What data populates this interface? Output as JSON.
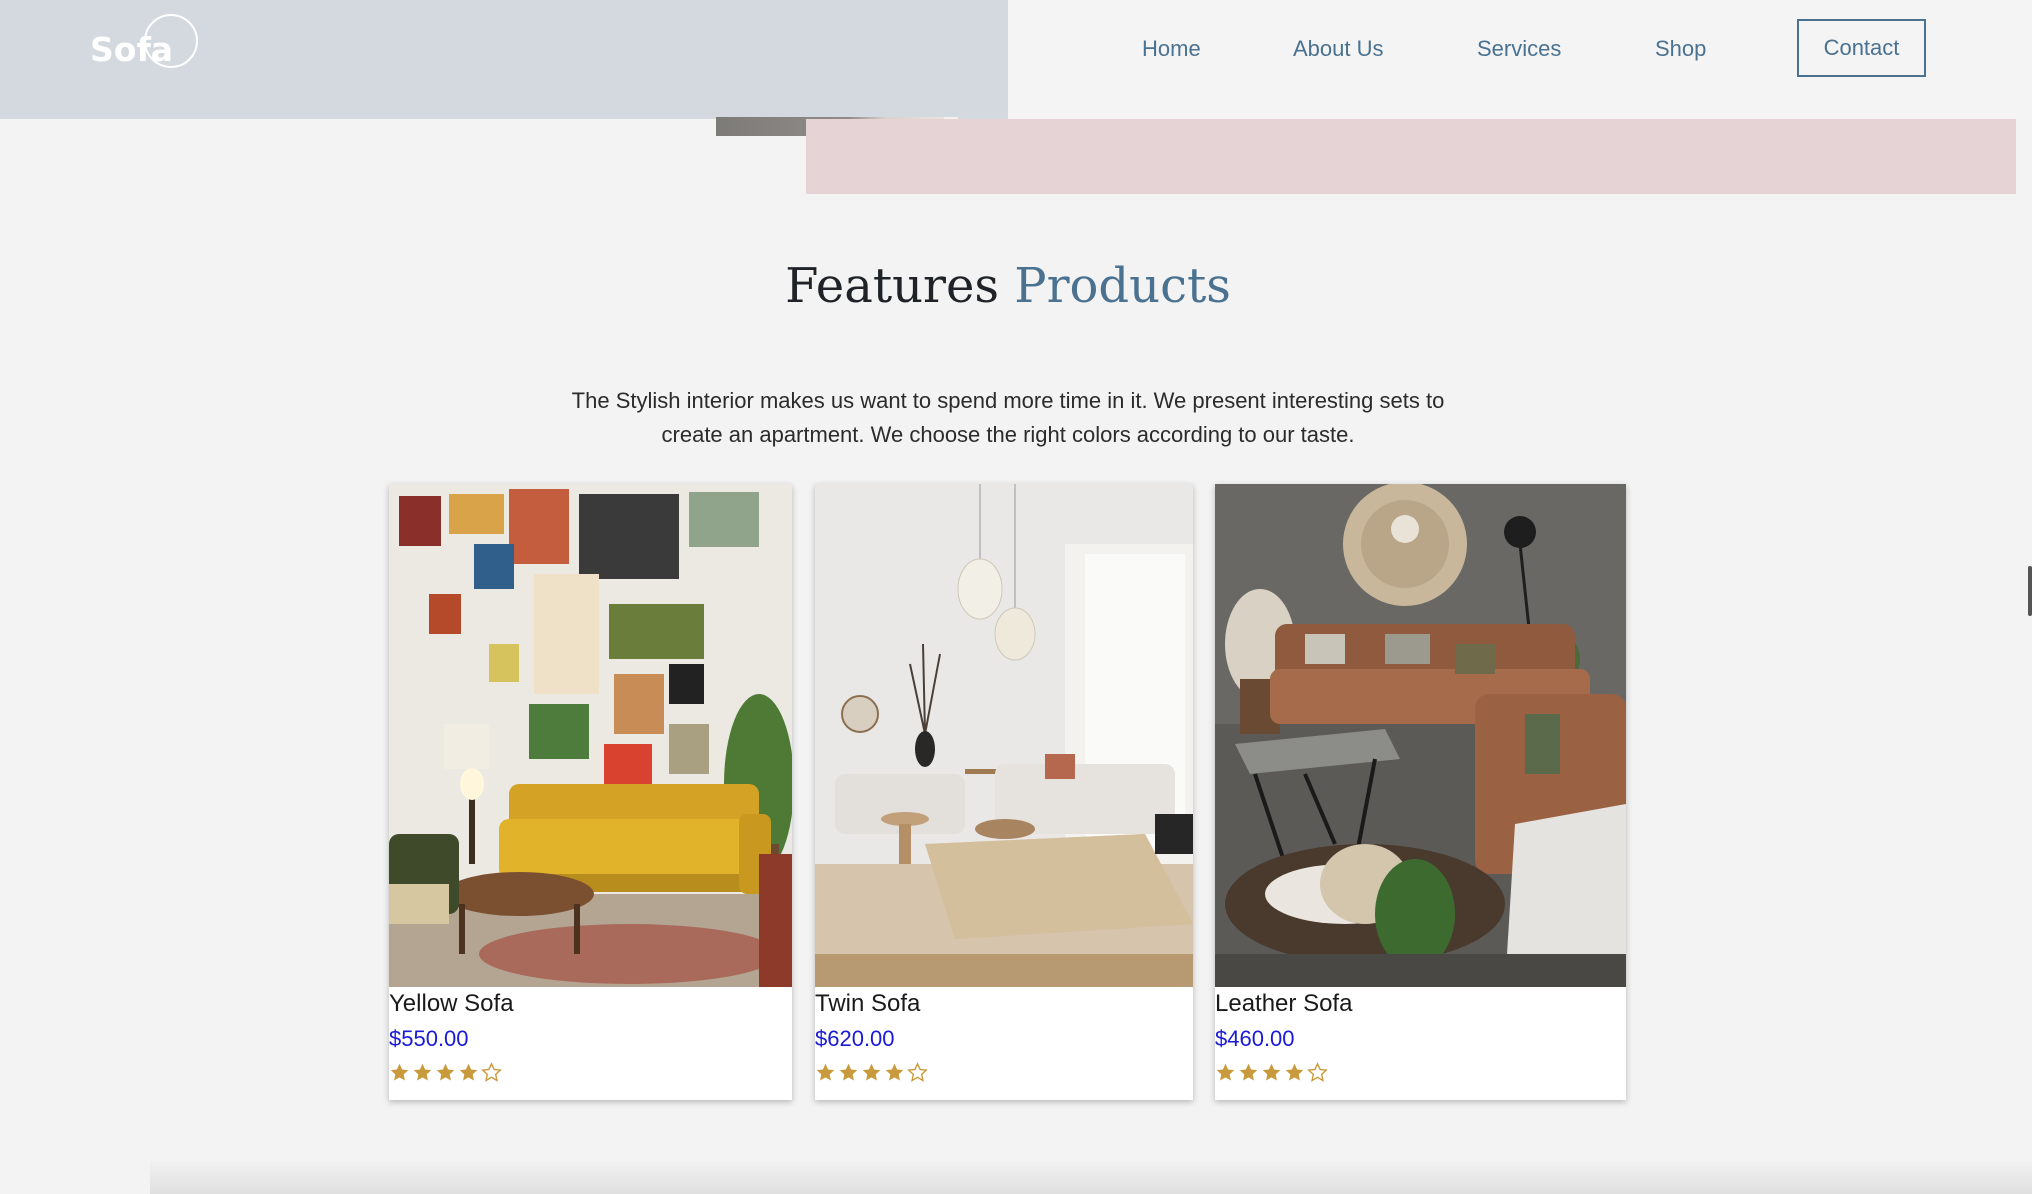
{
  "brand": {
    "logo_text": "Sofa"
  },
  "nav": {
    "items": [
      {
        "label": "Home"
      },
      {
        "label": "About Us"
      },
      {
        "label": "Services"
      },
      {
        "label": "Shop"
      }
    ],
    "contact_label": "Contact"
  },
  "section": {
    "title_main": "Features ",
    "title_accent": "Products",
    "description": "The Stylish interior makes us want to spend more time in it. We present interesting sets to create an apartment. We choose the right colors according to our taste."
  },
  "products": [
    {
      "name": "Yellow Sofa",
      "price": "$550.00",
      "rating": 4,
      "max_rating": 5
    },
    {
      "name": "Twin Sofa",
      "price": "$620.00",
      "rating": 4,
      "max_rating": 5
    },
    {
      "name": "Leather Sofa",
      "price": "$460.00",
      "rating": 4,
      "max_rating": 5
    }
  ],
  "colors": {
    "accent": "#4a7290",
    "price": "#1a1ad6",
    "star": "#c89a3c",
    "header_left_bg": "#d3d9df",
    "pink_band": "#e6d3d5"
  }
}
